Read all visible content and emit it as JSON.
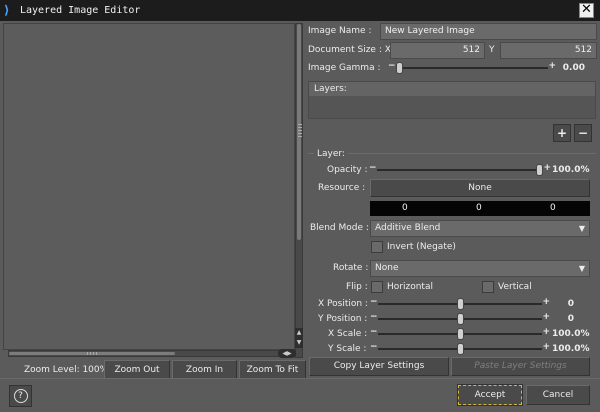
{
  "window": {
    "title": "Layered Image Editor",
    "close": "✕"
  },
  "canvas": {
    "zoom_level": "Zoom Level: 100%",
    "zoom_out": "Zoom Out",
    "zoom_in": "Zoom In",
    "zoom_to_fit": "Zoom To Fit"
  },
  "image": {
    "name_label": "Image Name :",
    "name_value": "New Layered Image",
    "size_label": "Document Size : X",
    "size_x": "512",
    "size_y_label": "Y",
    "size_y": "512",
    "gamma_label": "Image Gamma :",
    "gamma_value": "0.00",
    "gamma_fraction": 0.0
  },
  "layers": {
    "header": "Layers:",
    "add": "+",
    "remove": "−"
  },
  "layer": {
    "group_title": "Layer:",
    "opacity_label": "Opacity :",
    "opacity_value": "100.0%",
    "opacity_fraction": 1.0,
    "resource_label": "Resource :",
    "resource_value": "None",
    "color_values": [
      "0",
      "0",
      "0"
    ],
    "blend_label": "Blend Mode :",
    "blend_value": "Additive Blend",
    "invert_label": "Invert (Negate)",
    "rotate_label": "Rotate :",
    "rotate_value": "None",
    "flip_label": "Flip :",
    "flip_horizontal": "Horizontal",
    "flip_vertical": "Vertical",
    "x_pos_label": "X Position :",
    "x_pos_value": "0",
    "y_pos_label": "Y Position :",
    "y_pos_value": "0",
    "x_scale_label": "X Scale :",
    "x_scale_value": "100.0%",
    "y_scale_label": "Y Scale :",
    "y_scale_value": "100.0%",
    "copy_settings": "Copy Layer Settings",
    "paste_settings": "Paste Layer Settings"
  },
  "footer": {
    "help": "?",
    "accept": "Accept",
    "cancel": "Cancel"
  }
}
